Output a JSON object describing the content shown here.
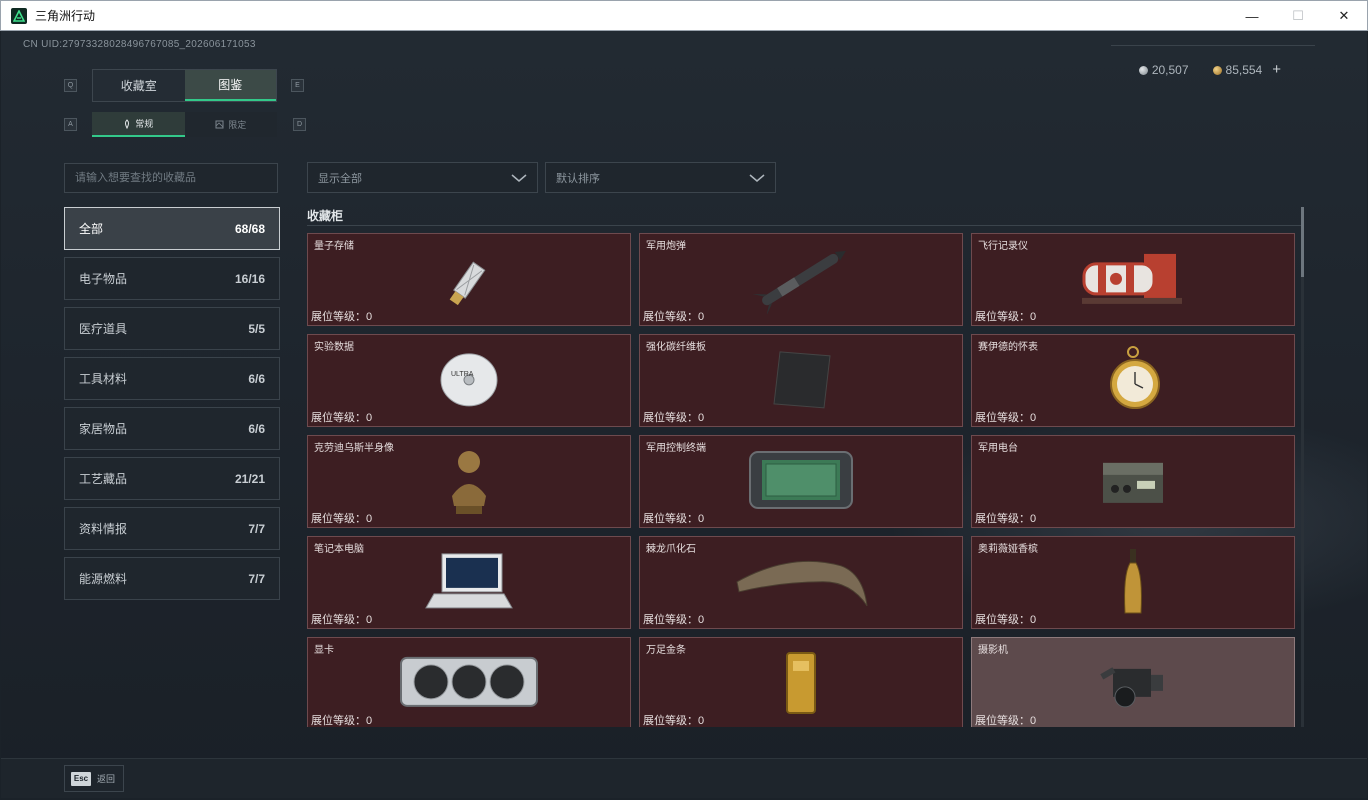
{
  "window": {
    "title": "三角洲行动",
    "minimize_icon": "minimize-icon",
    "maximize_icon": "maximize-icon",
    "close_icon": "close-icon"
  },
  "header": {
    "uid": "CN UID:2797332802849676​7085_202606171053",
    "silver": "20,507",
    "gold": "85,554",
    "plus": "+"
  },
  "keys": {
    "q": "Q",
    "e": "E",
    "a": "A",
    "d": "D"
  },
  "tabs": [
    {
      "label": "收藏室",
      "active": false
    },
    {
      "label": "图鉴",
      "active": true
    }
  ],
  "subtabs": [
    {
      "label": "常规",
      "active": true
    },
    {
      "label": "限定",
      "active": false
    }
  ],
  "search": {
    "placeholder": "请输入想要查找的收藏品"
  },
  "categories": [
    {
      "label": "全部",
      "count": "68/68",
      "active": true
    },
    {
      "label": "电子物品",
      "count": "16/16"
    },
    {
      "label": "医疗道具",
      "count": "5/5"
    },
    {
      "label": "工具材料",
      "count": "6/6"
    },
    {
      "label": "家居物品",
      "count": "6/6"
    },
    {
      "label": "工艺藏品",
      "count": "21/21"
    },
    {
      "label": "资料情报",
      "count": "7/7"
    },
    {
      "label": "能源燃料",
      "count": "7/7"
    }
  ],
  "filters": {
    "show": "显示全部",
    "sort": "默认排序"
  },
  "section": {
    "title": "收藏柜"
  },
  "level_label": "展位等级：",
  "items": [
    {
      "name": "量子存储",
      "level": "0",
      "icon": "usb-drive-icon"
    },
    {
      "name": "军用炮弹",
      "level": "0",
      "icon": "missile-icon"
    },
    {
      "name": "飞行记录仪",
      "level": "0",
      "icon": "flight-recorder-icon"
    },
    {
      "name": "实验数据",
      "level": "0",
      "icon": "disc-icon"
    },
    {
      "name": "强化碳纤维板",
      "level": "0",
      "icon": "carbon-plate-icon"
    },
    {
      "name": "赛伊德的怀表",
      "level": "0",
      "icon": "pocket-watch-icon"
    },
    {
      "name": "克劳迪乌斯半身像",
      "level": "0",
      "icon": "bust-icon"
    },
    {
      "name": "军用控制终端",
      "level": "0",
      "icon": "control-terminal-icon"
    },
    {
      "name": "军用电台",
      "level": "0",
      "icon": "radio-icon"
    },
    {
      "name": "笔记本电脑",
      "level": "0",
      "icon": "laptop-icon"
    },
    {
      "name": "棘龙爪化石",
      "level": "0",
      "icon": "claw-fossil-icon"
    },
    {
      "name": "奥莉薇娅香槟",
      "level": "0",
      "icon": "champagne-icon"
    },
    {
      "name": "显卡",
      "level": "0",
      "icon": "gpu-icon"
    },
    {
      "name": "万足金条",
      "level": "0",
      "icon": "gold-bar-icon"
    },
    {
      "name": "摄影机",
      "level": "0",
      "icon": "camera-icon",
      "highlight": true
    }
  ],
  "footer": {
    "esc_key": "Esc",
    "back_label": "返回"
  }
}
